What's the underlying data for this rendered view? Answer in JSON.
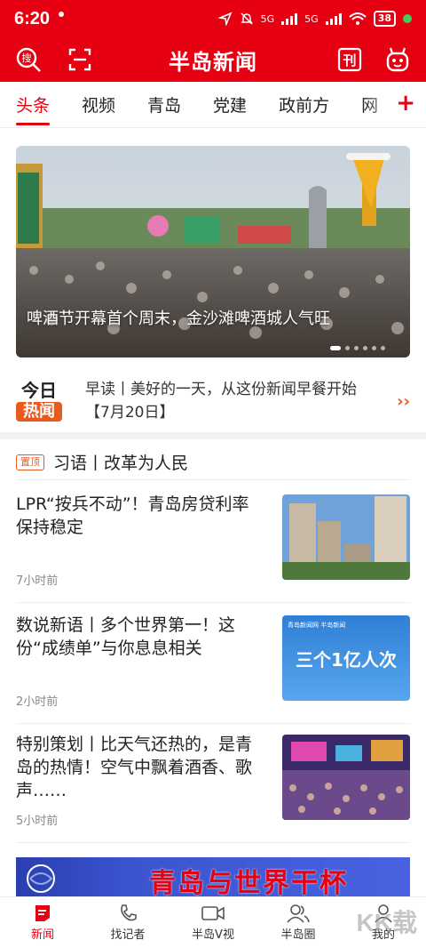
{
  "status": {
    "time": "6:20",
    "net1": "5G",
    "net2": "5G",
    "battery": "38"
  },
  "header": {
    "logo": "半岛新闻",
    "search_icon": "search-icon",
    "scan_icon": "scan-icon",
    "paper_label": "刊",
    "robot_icon": "robot-icon"
  },
  "tabs": [
    {
      "label": "头条",
      "active": true
    },
    {
      "label": "视频"
    },
    {
      "label": "青岛"
    },
    {
      "label": "党建"
    },
    {
      "label": "政前方"
    },
    {
      "label": "网红"
    }
  ],
  "tabs_more": "+",
  "banner": {
    "caption": "啤酒节开幕首个周末，金沙滩啤酒城人气旺"
  },
  "hot": {
    "badge_top": "今日",
    "badge_bottom": "热闻",
    "text": "早读丨美好的一天，从这份新闻早餐开始【7月20日】",
    "arrow": "››"
  },
  "pinned": {
    "badge": "置顶",
    "text": "习语丨改革为人民"
  },
  "news": [
    {
      "title": "LPR“按兵不动”！青岛房贷利率保持稳定",
      "time": "7小时前"
    },
    {
      "title": "数说新语丨多个世界第一！这份“成绩单”与你息息相关",
      "time": "2小时前",
      "thumb_text_big": "三个1亿人次",
      "thumb_small": "青岛新闻网 半岛新闻"
    },
    {
      "title": "特别策划丨比天气还热的，是青岛的热情！空气中飘着酒香、歌声……",
      "time": "5小时前"
    }
  ],
  "ad": {
    "text": "青岛与世界干杯"
  },
  "bottom_nav": [
    {
      "label": "新闻",
      "active": true
    },
    {
      "label": "找记者"
    },
    {
      "label": "半岛V视"
    },
    {
      "label": "半岛圈"
    },
    {
      "label": "我的"
    }
  ],
  "watermark": "KK载",
  "colors": {
    "brand_red": "#e60012",
    "hot_orange": "#e85a1e"
  }
}
